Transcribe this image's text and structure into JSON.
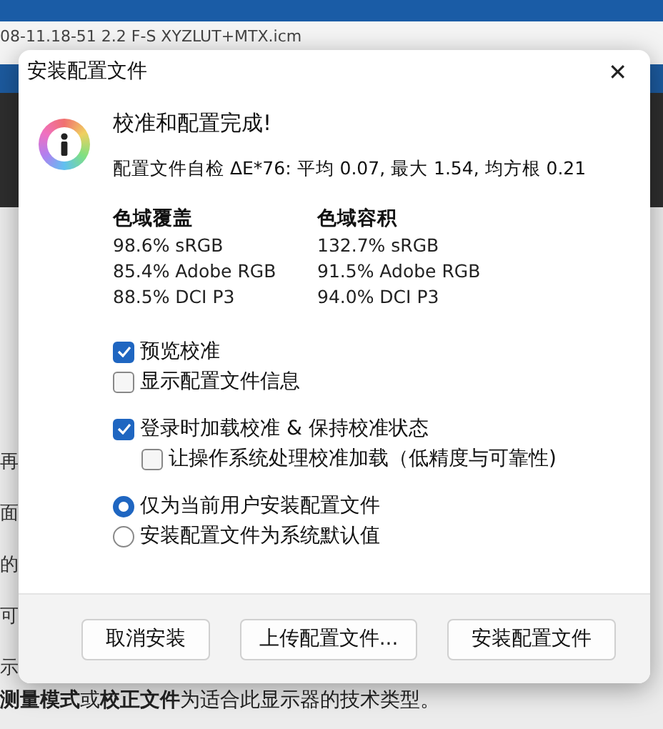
{
  "background": {
    "file_title": "08-11.18-51 2.2 F-S XYZLUT+MTX.icm",
    "left_fragments": [
      "再",
      "面",
      "的",
      "可",
      "示"
    ],
    "lines": [
      "**测量模式**或**校正文件**为适合此显示器的技术类型。"
    ]
  },
  "dialog": {
    "title": "安装配置文件",
    "close": "✕",
    "heading": "校准和配置完成!",
    "summary": "配置文件自检 ΔE*76: 平均 0.07, 最大 1.54, 均方根 0.21",
    "gamut_columns": [
      {
        "title": "色域覆盖",
        "rows": [
          "98.6% sRGB",
          "85.4% Adobe RGB",
          "88.5% DCI P3"
        ]
      },
      {
        "title": "色域容积",
        "rows": [
          "132.7% sRGB",
          "91.5% Adobe RGB",
          "94.0% DCI P3"
        ]
      }
    ],
    "option_groups": [
      [
        {
          "kind": "checkbox",
          "label": "预览校准",
          "checked": true
        },
        {
          "kind": "checkbox",
          "label": "显示配置文件信息",
          "checked": false
        }
      ],
      [
        {
          "kind": "checkbox",
          "label": "登录时加载校准 & 保持校准状态",
          "checked": true
        },
        {
          "kind": "sub_checkbox",
          "label": "让操作系统处理校准加载（低精度与可靠性)",
          "checked": false
        }
      ],
      [
        {
          "kind": "radio",
          "label": "仅为当前用户安装配置文件",
          "selected": true
        },
        {
          "kind": "radio",
          "label": "安装配置文件为系统默认值",
          "selected": false
        }
      ]
    ],
    "buttons": [
      "取消安装",
      "上传配置文件...",
      "安装配置文件"
    ]
  }
}
